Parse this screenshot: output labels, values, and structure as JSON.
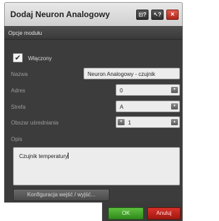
{
  "window": {
    "title": "Dodaj Neuron Analogowy",
    "buttons": {
      "help_label": "⊡?",
      "context_help_label": "↖?",
      "close_label": "×"
    }
  },
  "section": {
    "title": "Opcje modułu"
  },
  "form": {
    "enabled": {
      "checked": true,
      "check_mark": "✔",
      "label": "Włączony"
    },
    "name": {
      "label": "Nazwa",
      "value": "Neuron Analogowy - czujnik"
    },
    "address": {
      "label": "Adres",
      "value": "0"
    },
    "zone": {
      "label": "Strefa",
      "value": "A"
    },
    "averaging_area": {
      "label": "Obszar uśredniania",
      "value": "1"
    },
    "description": {
      "label": "Opis",
      "value": "Czujnik temperatury"
    },
    "config_button_label": "Konfiguracja wejść / wyjść..."
  },
  "footer": {
    "ok_label": "OK",
    "cancel_label": "Anuluj"
  },
  "icons": {
    "dropdown": "▾",
    "spin_down": "▾",
    "spin_up": "▴"
  }
}
